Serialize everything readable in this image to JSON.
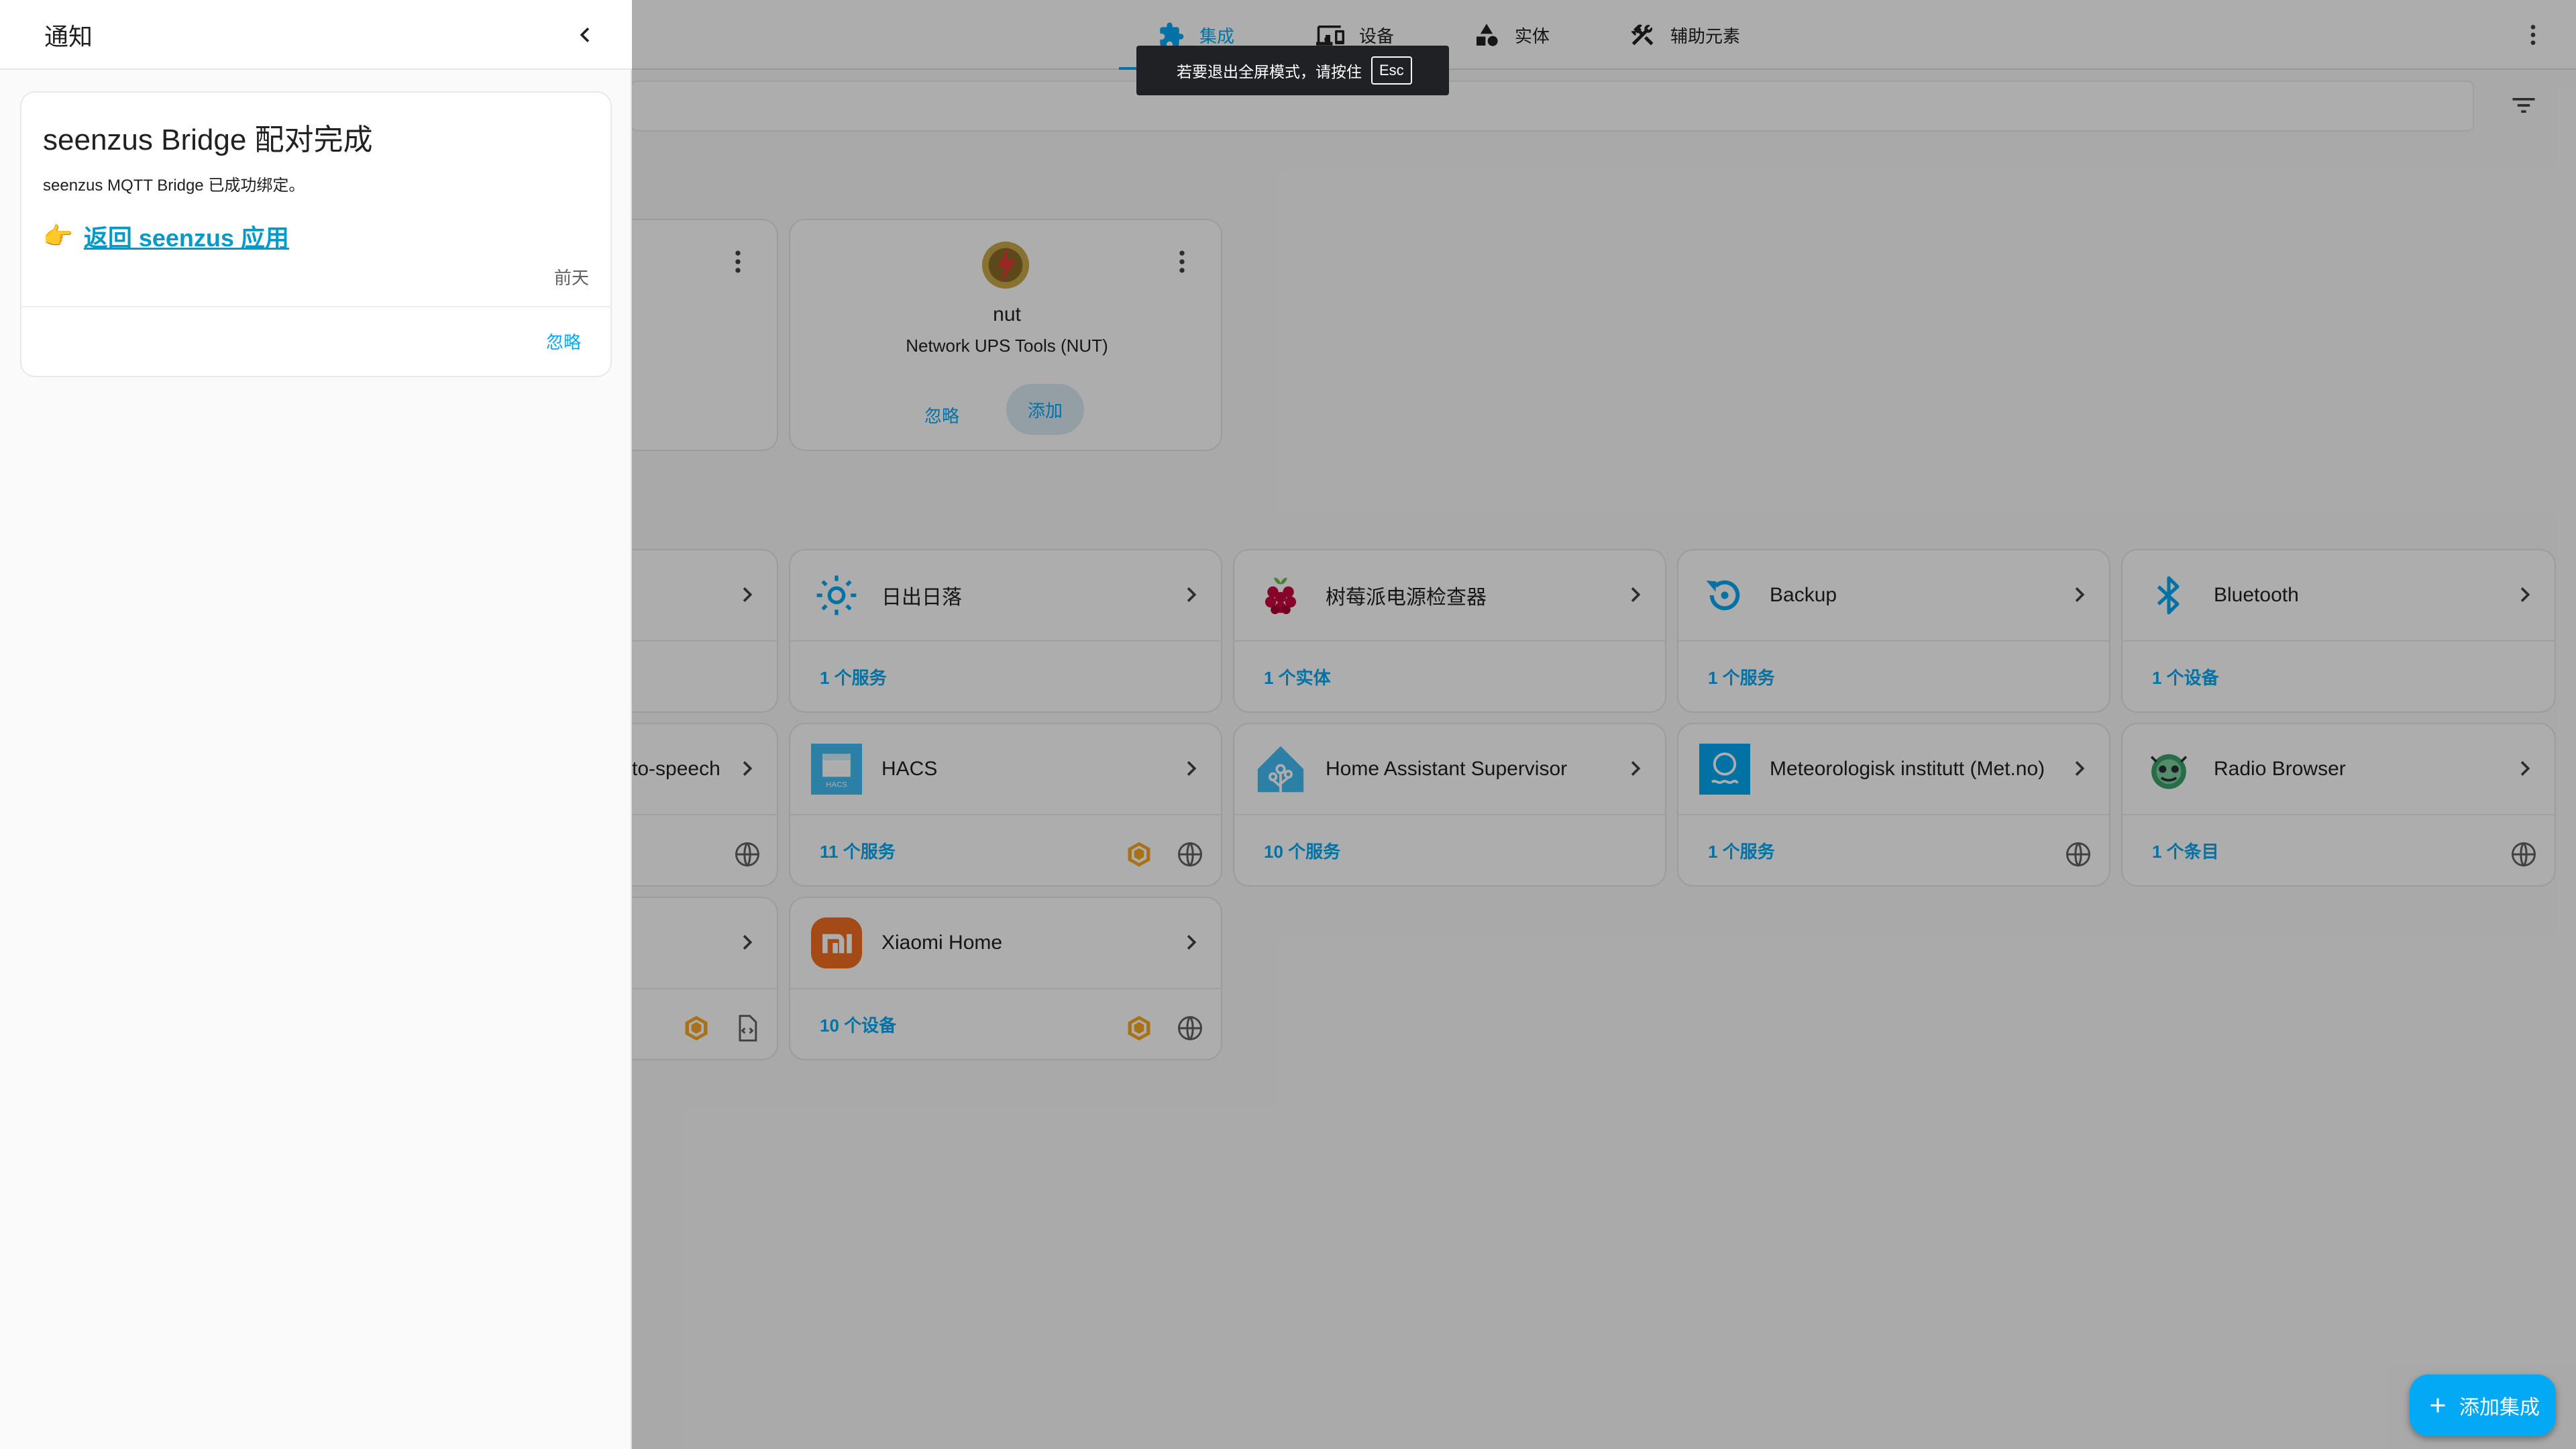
{
  "topbar": {
    "tabs": [
      {
        "label": "集成",
        "icon": "puzzle-icon",
        "active": true
      },
      {
        "label": "设备",
        "icon": "devices-icon",
        "active": false
      },
      {
        "label": "实体",
        "icon": "shapes-icon",
        "active": false
      },
      {
        "label": "辅助元素",
        "icon": "tools-icon",
        "active": false
      }
    ]
  },
  "toast": {
    "text": "若要退出全屏模式，请按住",
    "key": "Esc"
  },
  "discovered": {
    "nut": {
      "name": "nut",
      "subtitle": "Network UPS Tools (NUT)",
      "ignore": "忽略",
      "add": "添加"
    }
  },
  "integrations": [
    {
      "title": "日出日落",
      "foot": "1 个服务",
      "icon": "sun-icon"
    },
    {
      "title": "树莓派电源检查器",
      "foot": "1 个实体",
      "icon": "raspberry-pi-icon"
    },
    {
      "title": "Backup",
      "foot": "1 个服务",
      "icon": "backup-icon"
    },
    {
      "title": "Bluetooth",
      "foot": "1 个设备",
      "icon": "bluetooth-icon"
    },
    {
      "title": "to-speech",
      "foot": "",
      "icon": ""
    },
    {
      "title": "HACS",
      "foot": "11 个服务",
      "icon": "hacs-icon"
    },
    {
      "title": "Home Assistant Supervisor",
      "foot": "10 个服务",
      "icon": "home-assistant-icon"
    },
    {
      "title": "Meteorologisk institutt (Met.no)",
      "foot": "1 个服务",
      "icon": "met-no-icon"
    },
    {
      "title": "Radio Browser",
      "foot": "1 个条目",
      "icon": "radio-browser-icon"
    },
    {
      "title": "Xiaomi Home",
      "foot": "10 个设备",
      "icon": "xiaomi-icon"
    }
  ],
  "fab": {
    "label": "添加集成"
  },
  "drawer": {
    "title": "通知",
    "notification": {
      "title": "seenzus Bridge 配对完成",
      "body": "seenzus MQTT Bridge 已成功绑定。",
      "link_emoji": "👉",
      "link_text": "返回 seenzus 应用",
      "time": "前天",
      "dismiss": "忽略"
    }
  },
  "colors": {
    "accent": "#03a9f4",
    "xiaomi": "#f26d21",
    "hacs": "#41bdf5"
  }
}
